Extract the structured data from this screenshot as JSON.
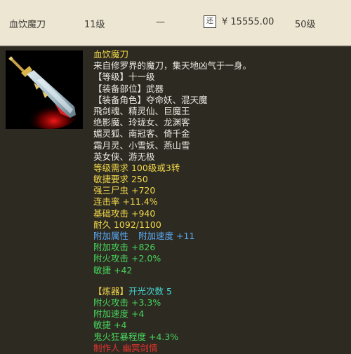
{
  "listing": {
    "name": "血饮魔刀",
    "level": "11级",
    "dash": "—",
    "badge": "还",
    "price": "¥ 15555.00",
    "min_level": "50级"
  },
  "item": {
    "icon": "sword-icon",
    "title": "血饮魔刀",
    "desc": "来自修罗界的魔刀，集天地凶气于一身。",
    "grade": "【等级】十一级",
    "slot": "【装备部位】武器",
    "roles_header": "【装备角色】夺命妖、混天魔",
    "roles": [
      "飛剑魂、精灵仙、巨魔王",
      "绝影魔、玲珑女、龙渊客",
      "媚灵狐、南冠客、倚千金",
      "霜月灵、小雪妖、燕山雪",
      "英女侠、游无极"
    ],
    "stats": [
      "等级需求 100级或3转",
      "敏捷要求 250",
      "强三尸虫 +720",
      "连击率 +11.4%",
      "基础攻击 +940",
      "耐久 1092/1100"
    ],
    "attr_label": "附加属性",
    "attr_value": "附加速度 +11",
    "extra": [
      "附加攻击 +826",
      "附火攻击 +2.0%",
      "敏捷 +42"
    ],
    "refine_label": "【炼器】",
    "refine_value": "开光次数 5",
    "refine_stats": [
      "附火攻击 +3.3%",
      "附加速度 +4",
      "敏捷 +4",
      "鬼火狂暴程度 +4.3%"
    ],
    "maker": "制作人 幽冥剑情"
  },
  "colors": {
    "gold": "#f2d84a",
    "white": "#ecebe4",
    "green": "#47d35a",
    "blue": "#5aa9f4",
    "cyan": "#44d6d0",
    "red": "#e0352c"
  }
}
